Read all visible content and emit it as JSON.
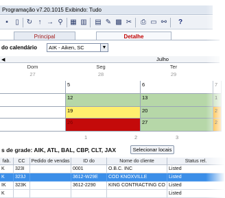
{
  "window": {
    "title": "Programação v7.20.1015  Exibindo: Tudo"
  },
  "toolbar": {
    "icons": [
      "save-icon",
      "delete-icon",
      "refresh-icon",
      "up-icon",
      "arrow-icon",
      "filter-icon",
      "calendar-icon",
      "calendar-alt-icon",
      "chart-icon",
      "edit-icon",
      "grid-icon",
      "tools-icon",
      "print-icon",
      "window-icon",
      "find-icon",
      "help-icon"
    ]
  },
  "tabs": [
    {
      "label": "Principal"
    },
    {
      "label": "Detalhe"
    }
  ],
  "calendar_selector": {
    "label": "do calendário",
    "value": "AIK - Aiken, SC"
  },
  "calendar": {
    "month": "Julho",
    "days": [
      {
        "name": "Dom",
        "num": "27"
      },
      {
        "name": "Seg",
        "num": "28"
      },
      {
        "name": "Ter",
        "num": "29"
      }
    ],
    "rows": [
      {
        "cells": [
          "",
          "5",
          "6",
          "7"
        ],
        "colors": [
          "white",
          "white",
          "white",
          "white"
        ]
      },
      {
        "cells": [
          "",
          "12",
          "13",
          "1"
        ],
        "colors": [
          "white",
          "green",
          "green",
          "green"
        ]
      },
      {
        "cells": [
          "",
          "19",
          "20",
          "2"
        ],
        "colors": [
          "white",
          "yellow",
          "green",
          "orange"
        ]
      },
      {
        "cells": [
          "",
          "26",
          "27",
          "2"
        ],
        "colors": [
          "white",
          "red",
          "green",
          "orange"
        ]
      }
    ],
    "below_nums": [
      "1",
      "2",
      "3"
    ]
  },
  "grid_section": {
    "label": "s de grade: AIK, ATL, BAL, CBP, CLT, JAX",
    "button": "Selecionar locais"
  },
  "table": {
    "columns": [
      "fab.",
      "CC",
      "Pedido de vendas",
      "ID do",
      "Nome do cliente",
      "Status rel."
    ],
    "rows": [
      {
        "fab": "K",
        "cc": "323I",
        "pedido": "",
        "id": "0001",
        "nome": "O.B.C. INC",
        "status": "Listed",
        "selected": false
      },
      {
        "fab": "K",
        "cc": "323J",
        "pedido": "",
        "id": "3612-W29E",
        "nome": "COD KNOXVILLE",
        "status": "Listed",
        "selected": true
      },
      {
        "fab": "IK",
        "cc": "323K",
        "pedido": "",
        "id": "3612-2290",
        "nome": "KING CONTRACTING CO II",
        "status": "Listed",
        "selected": false
      },
      {
        "fab": "K",
        "cc": "",
        "pedido": "",
        "id": "",
        "nome": "",
        "status": "Listed",
        "selected": false
      }
    ]
  }
}
